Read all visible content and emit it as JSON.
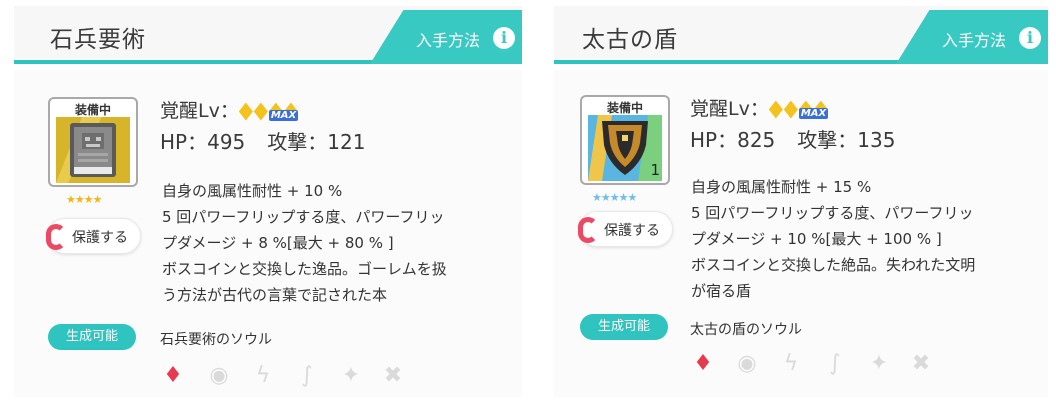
{
  "cards": [
    {
      "title": "石兵要術",
      "acquire_label": "入手方法",
      "info_glyph": "i",
      "equipped_label": "装備中",
      "stars": "★★★★",
      "protect_label": "保護する",
      "awaken_label": "覚醒Lv：",
      "max_label": "MAX",
      "hp": "HP：495",
      "atk": "攻撃：121",
      "description_lines": [
        "自身の風属性耐性 + 10 %",
        "5 回パワーフリップする度、パワーフリッ",
        "プダメージ + 8 %[最大 + 80 % ]",
        "ボスコインと交換した逸品。ゴーレムを扱",
        "う方法が古代の言葉で記された本"
      ],
      "generate_label": "生成可能",
      "soul_label": "石兵要術のソウル",
      "elements": [
        "fire-icon",
        "water-icon",
        "thunder-icon",
        "wind-icon",
        "light-icon",
        "dark-icon"
      ],
      "accent_color": "#2fc4c0",
      "fire_color": "#e83a4f"
    },
    {
      "title": "太古の盾",
      "acquire_label": "入手方法",
      "info_glyph": "i",
      "equipped_label": "装備中",
      "stars": "★★★★★",
      "count_label": "1",
      "protect_label": "保護する",
      "awaken_label": "覚醒Lv：",
      "max_label": "MAX",
      "hp": "HP：825",
      "atk": "攻撃：135",
      "description_lines": [
        "自身の風属性耐性 + 15 %",
        "5 回パワーフリップする度、パワーフリッ",
        "プダメージ + 10 %[最大 + 100 % ]",
        "ボスコインと交換した絶品。失われた文明",
        "が宿る盾"
      ],
      "generate_label": "生成可能",
      "soul_label": "太古の盾のソウル",
      "elements": [
        "fire-icon",
        "water-icon",
        "thunder-icon",
        "wind-icon",
        "light-icon",
        "dark-icon"
      ],
      "accent_color": "#2fc4c0",
      "fire_color": "#e83a4f"
    }
  ]
}
